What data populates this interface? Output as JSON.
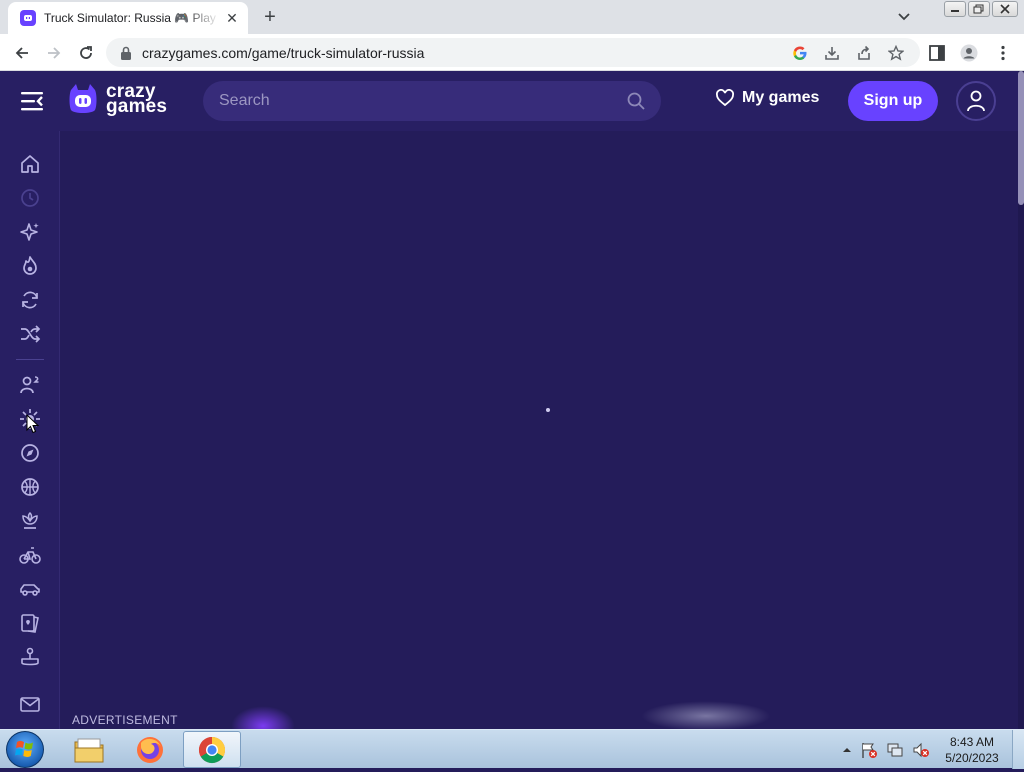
{
  "browser": {
    "tab": {
      "title": "Truck Simulator: Russia 🎮 Play Truck Simulator: Russia",
      "close_label": "✕"
    },
    "new_tab_label": "+",
    "url": "crazygames.com/game/truck-simulator-russia"
  },
  "site": {
    "logo_line1": "crazy",
    "logo_line2": "games",
    "search_placeholder": "Search",
    "my_games_label": "My games",
    "signup_label": "Sign up",
    "brand_color": "#6842ff",
    "background_color": "#241c5a"
  },
  "sidebar": {
    "items": [
      {
        "icon": "home-icon"
      },
      {
        "icon": "recent-icon"
      },
      {
        "icon": "new-icon"
      },
      {
        "icon": "trending-icon"
      },
      {
        "icon": "updated-icon"
      },
      {
        "icon": "random-icon"
      },
      {
        "icon": "two-player-icon"
      },
      {
        "icon": "action-icon"
      },
      {
        "icon": "adventure-icon"
      },
      {
        "icon": "basketball-icon"
      },
      {
        "icon": "beauty-icon"
      },
      {
        "icon": "bike-icon"
      },
      {
        "icon": "car-icon"
      },
      {
        "icon": "card-icon"
      },
      {
        "icon": "controller-icon"
      },
      {
        "icon": "mail-icon"
      }
    ]
  },
  "main": {
    "advertisement_label": "ADVERTISEMENT"
  },
  "taskbar": {
    "time": "8:43 AM",
    "date": "5/20/2023",
    "apps": [
      "file-explorer",
      "firefox",
      "chrome"
    ]
  }
}
